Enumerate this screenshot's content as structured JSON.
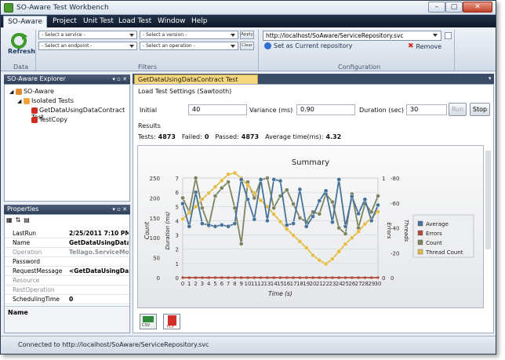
{
  "window": {
    "title": "SO-Aware Test Workbench",
    "min": "–",
    "max": "▢",
    "close": "✕"
  },
  "menu": [
    "SO-Aware",
    "Project",
    "Unit Test",
    "Load Test",
    "Window",
    "Help"
  ],
  "ribbon": {
    "refresh_label": "Refresh",
    "data_group": "Data",
    "filters_group": "Filters",
    "config_group": "Configuration",
    "service_placeholder": "- Select a service -",
    "version_placeholder": "- Select a version -",
    "endpoint_placeholder": "- Select an endpoint -",
    "operation_placeholder": "- Select an operation -",
    "apply_label": "Apply",
    "clear_label": "Clear",
    "url_value": "http://localhost/SoAware/ServiceRepository.svc",
    "set_current_label": "Set as Current repository",
    "remove_label": "Remove"
  },
  "explorer": {
    "title": "SO-Aware Explorer",
    "root": "SO-Aware",
    "group": "Isolated Tests",
    "items": [
      "GetDataUsingDataContract Test",
      "TestCopy"
    ]
  },
  "properties": {
    "title": "Properties",
    "rows": [
      {
        "k": "LastRun",
        "v": "2/25/2011 7:10 PM"
      },
      {
        "k": "Name",
        "v": "GetDataUsingDataC"
      },
      {
        "k": "Operation",
        "v": "Tellago.ServiceMod"
      },
      {
        "k": "Password",
        "v": ""
      },
      {
        "k": "RequestMessage",
        "v": "<GetDataUsingData"
      },
      {
        "k": "Resource",
        "v": ""
      },
      {
        "k": "RestOperation",
        "v": ""
      },
      {
        "k": "SchedulingTime",
        "v": "0"
      }
    ],
    "footer": "Name"
  },
  "tab": {
    "label": "GetDataUsingDataContract Test Load Test",
    "close": "✕"
  },
  "settings": {
    "title": "Load Test Settings (Sawtooth)",
    "initial_label": "Initial",
    "initial_value": "40",
    "variance_label": "Variance (ms)",
    "variance_value": "0.90",
    "duration_label": "Duration (sec)",
    "duration_value": "30",
    "run_label": "Run",
    "stop_label": "Stop"
  },
  "results": {
    "title": "Results",
    "tests_label": "Tests:",
    "tests_value": "4873",
    "failed_label": "Failed:",
    "failed_value": "0",
    "passed_label": "Passed:",
    "passed_value": "4873",
    "avg_label": "Average time(ms):",
    "avg_value": "4.32"
  },
  "status": {
    "text": "Connected to http://localhost/SoAware/ServiceRepository.svc"
  },
  "export": {
    "excel_caption": "CSV",
    "pdf_caption": "PDF"
  },
  "colors": {
    "average": "#47729a",
    "errors": "#b04a3e",
    "count": "#7d8460",
    "thread": "#e2bd48"
  },
  "chart_data": {
    "type": "line",
    "title": "Summary",
    "xlabel": "Time (s)",
    "ylabel_left_outer": "Count",
    "ylabel_left_inner": "Duration (ms)",
    "ylabel_right_inner": "Errors",
    "ylabel_right_outer": "Threads",
    "x": [
      0,
      1,
      2,
      3,
      4,
      5,
      6,
      7,
      8,
      9,
      10,
      11,
      12,
      13,
      14,
      15,
      16,
      17,
      18,
      19,
      20,
      21,
      22,
      23,
      24,
      25,
      26,
      27,
      28,
      29,
      30
    ],
    "x_ticks": [
      "0",
      "1",
      "2",
      "3",
      "4",
      "5",
      "6",
      "7",
      "8",
      "9",
      "10",
      "11",
      "12",
      "13",
      "14",
      "15",
      "16",
      "17",
      "18",
      "19",
      "20",
      "21",
      "22",
      "23",
      "24",
      "25",
      "26",
      "27",
      "28",
      "29",
      "30"
    ],
    "count_ticks": [
      "0",
      "50",
      "100",
      "150",
      "200",
      "250"
    ],
    "duration_ticks": [
      "0",
      "1",
      "2",
      "3",
      "4",
      "5",
      "6",
      "7"
    ],
    "errors_ticks": [
      "0",
      "1"
    ],
    "threads_ticks": [
      "0",
      "-20",
      "-40",
      "-60",
      "-80"
    ],
    "count_range": [
      0,
      250
    ],
    "duration_range": [
      0,
      7
    ],
    "threads_range": [
      0,
      80
    ],
    "legend": [
      "Average",
      "Errors",
      "Count",
      "Thread Count"
    ],
    "legend_position": "right",
    "series": [
      {
        "name": "Average",
        "axis": "duration",
        "values": [
          5.2,
          3.6,
          6.0,
          3.8,
          3.7,
          3.6,
          3.7,
          3.6,
          3.8,
          6.9,
          5.5,
          4.1,
          6.9,
          4.0,
          6.9,
          6.8,
          3.7,
          3.8,
          6.2,
          3.6,
          4.3,
          5.4,
          6.1,
          3.9,
          6.9,
          3.6,
          5.7,
          4.5,
          5.5,
          4.0,
          5.1
        ]
      },
      {
        "name": "Errors",
        "axis": "errors",
        "values": [
          0,
          0,
          0,
          0,
          0,
          0,
          0,
          0,
          0,
          0,
          0,
          0,
          0,
          0,
          0,
          0,
          0,
          0,
          0,
          0,
          0,
          0,
          0,
          0,
          0,
          0,
          0,
          0,
          0,
          0,
          0
        ]
      },
      {
        "name": "Count",
        "axis": "count",
        "values": [
          200,
          165,
          250,
          175,
          130,
          205,
          225,
          240,
          175,
          85,
          240,
          200,
          245,
          250,
          175,
          205,
          220,
          185,
          150,
          140,
          165,
          160,
          210,
          190,
          125,
          110,
          210,
          125,
          185,
          165,
          205
        ]
      },
      {
        "name": "Thread Count",
        "axis": "threads",
        "values": [
          47,
          52,
          57,
          63,
          68,
          73,
          78,
          83,
          84,
          80,
          74,
          68,
          62,
          57,
          51,
          45,
          39,
          34,
          29,
          24,
          18,
          14,
          11,
          15,
          21,
          27,
          32,
          37,
          43,
          48,
          53
        ]
      }
    ]
  }
}
